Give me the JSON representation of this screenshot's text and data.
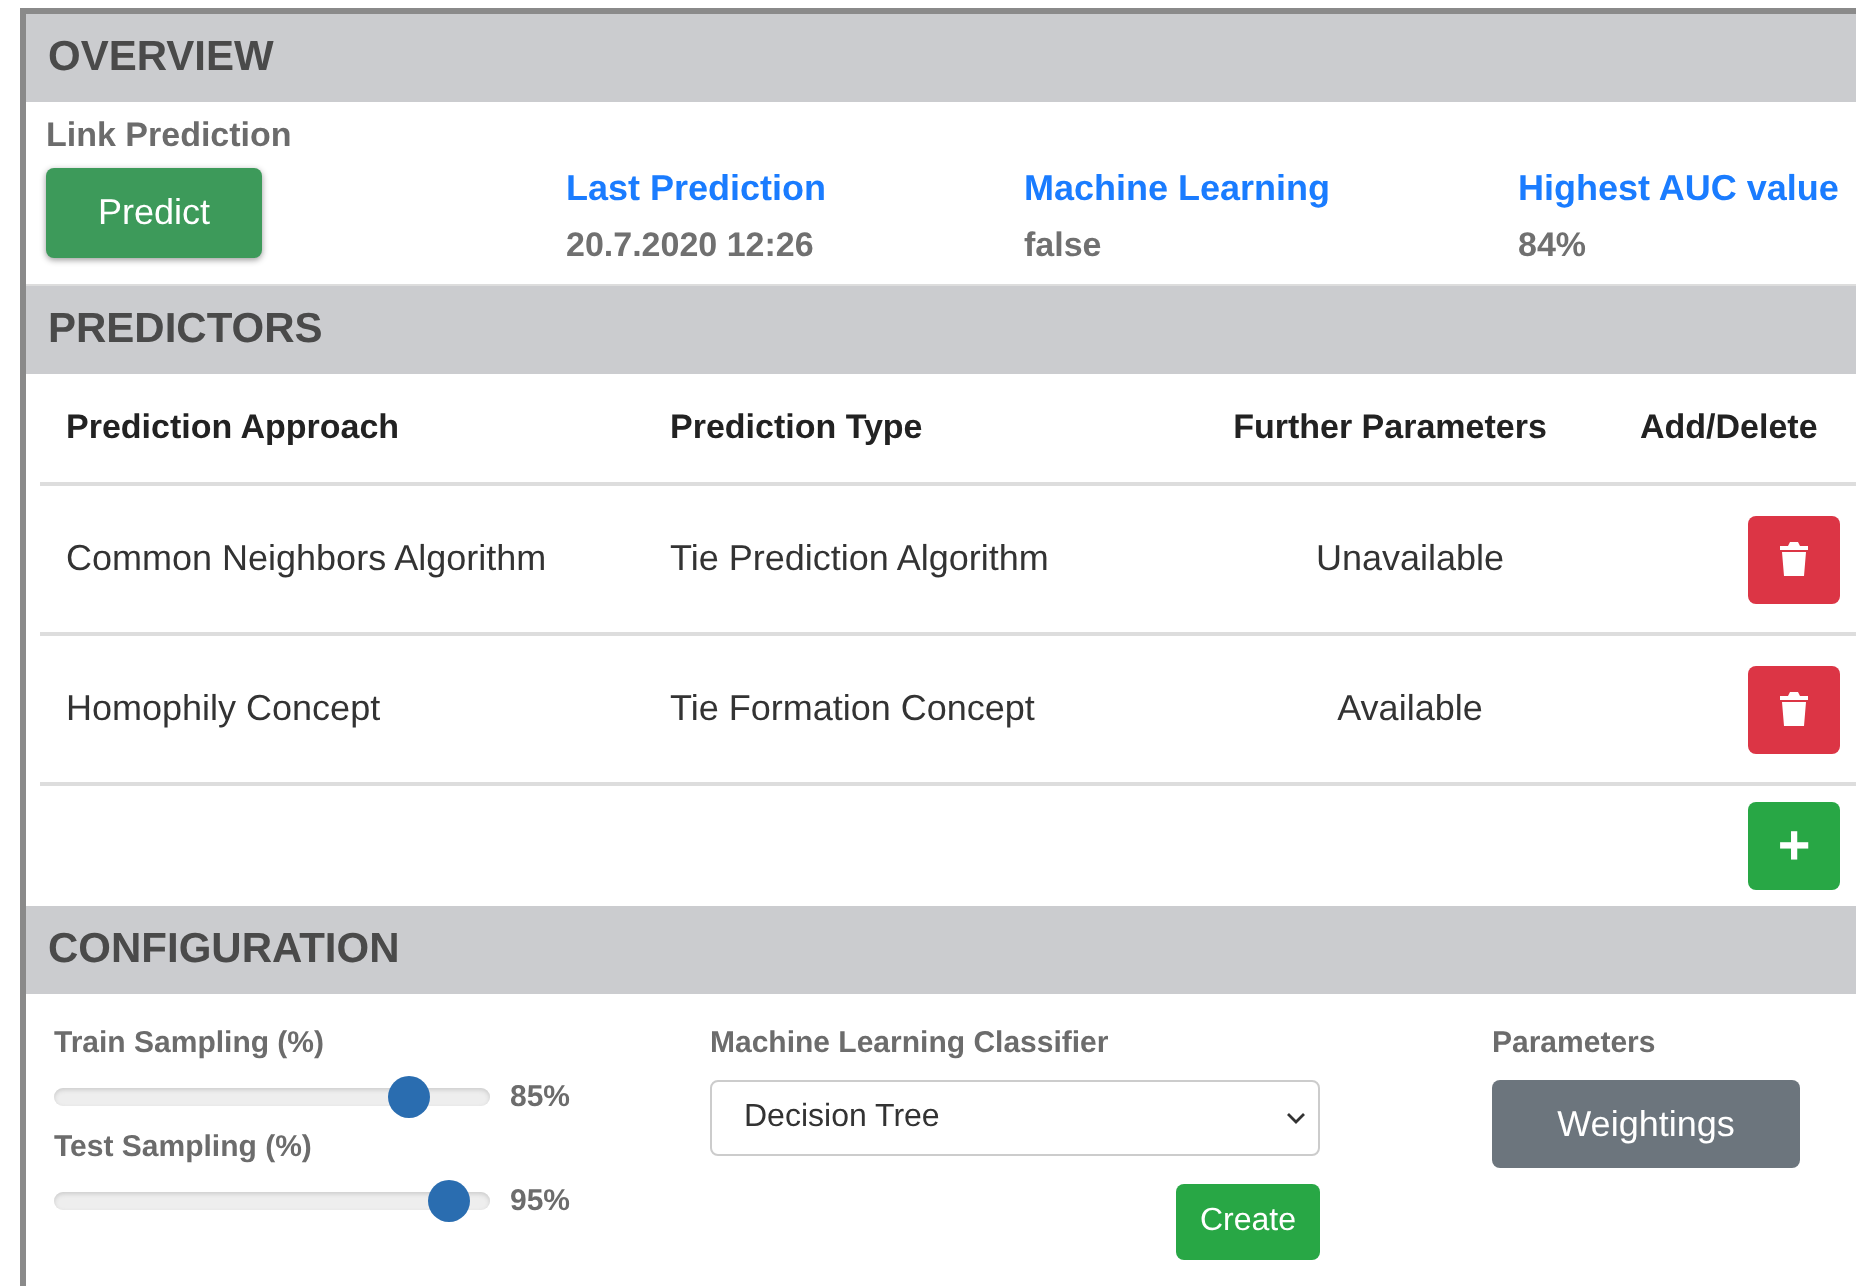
{
  "overview": {
    "title": "OVERVIEW",
    "link_label": "Link Prediction",
    "predict_button": "Predict",
    "stats": [
      {
        "label": "Last Prediction",
        "value": "20.7.2020 12:26"
      },
      {
        "label": "Machine Learning",
        "value": "false"
      },
      {
        "label": "Highest AUC value",
        "value": "84%"
      }
    ]
  },
  "predictors": {
    "title": "PREDICTORS",
    "columns": [
      "Prediction Approach",
      "Prediction Type",
      "Further Parameters",
      "Add/Delete"
    ],
    "rows": [
      {
        "approach": "Common Neighbors Algorithm",
        "type": "Tie Prediction Algorithm",
        "parameters": "Unavailable"
      },
      {
        "approach": "Homophily Concept",
        "type": "Tie Formation Concept",
        "parameters": "Available"
      }
    ],
    "add_button": "+"
  },
  "configuration": {
    "title": "CONFIGURATION",
    "sliders": [
      {
        "label": "Train Sampling (%)",
        "level": 0.85,
        "reading": "85%"
      },
      {
        "label": "Test Sampling (%)",
        "level": 0.95,
        "reading": "95%"
      }
    ],
    "classifier": {
      "label": "Machine Learning Classifier",
      "value": "Decision Tree"
    },
    "create_button": "Create",
    "parameters": {
      "label": "Parameters",
      "button": "Weightings"
    }
  }
}
